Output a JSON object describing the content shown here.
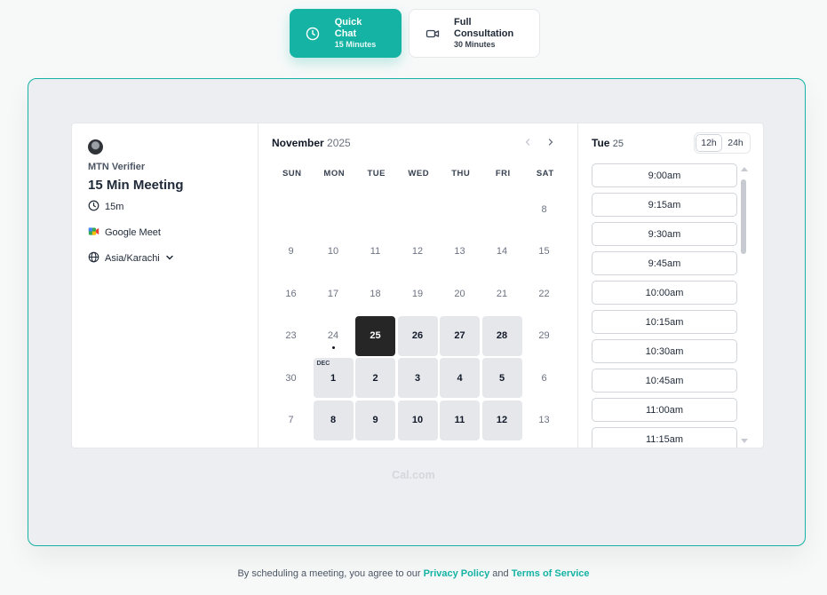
{
  "tabs": [
    {
      "title": "Quick Chat",
      "subtitle": "15 Minutes",
      "icon": "clock-icon"
    },
    {
      "title": "Full Consultation",
      "subtitle": "30 Minutes",
      "icon": "video-icon"
    }
  ],
  "event": {
    "organizer": "MTN Verifier",
    "title": "15 Min Meeting",
    "duration": "15m",
    "location": "Google Meet",
    "timezone": "Asia/Karachi"
  },
  "calendar": {
    "month": "November",
    "year": "2025",
    "weekdays": [
      "SUN",
      "MON",
      "TUE",
      "WED",
      "THU",
      "FRI",
      "SAT"
    ],
    "cells": [
      {
        "label": ""
      },
      {
        "label": ""
      },
      {
        "label": ""
      },
      {
        "label": ""
      },
      {
        "label": ""
      },
      {
        "label": ""
      },
      {
        "label": "8"
      },
      {
        "label": "9"
      },
      {
        "label": "10"
      },
      {
        "label": "11"
      },
      {
        "label": "12"
      },
      {
        "label": "13"
      },
      {
        "label": "14"
      },
      {
        "label": "15"
      },
      {
        "label": "16"
      },
      {
        "label": "17"
      },
      {
        "label": "18"
      },
      {
        "label": "19"
      },
      {
        "label": "20"
      },
      {
        "label": "21"
      },
      {
        "label": "22"
      },
      {
        "label": "23"
      },
      {
        "label": "24",
        "today": true
      },
      {
        "label": "25",
        "state": "selected"
      },
      {
        "label": "26",
        "state": "available"
      },
      {
        "label": "27",
        "state": "available"
      },
      {
        "label": "28",
        "state": "available"
      },
      {
        "label": "29"
      },
      {
        "label": "30"
      },
      {
        "label": "1",
        "state": "available",
        "month_tag": "DEC"
      },
      {
        "label": "2",
        "state": "available"
      },
      {
        "label": "3",
        "state": "available"
      },
      {
        "label": "4",
        "state": "available"
      },
      {
        "label": "5",
        "state": "available"
      },
      {
        "label": "6"
      },
      {
        "label": "7"
      },
      {
        "label": "8",
        "state": "available"
      },
      {
        "label": "9",
        "state": "available"
      },
      {
        "label": "10",
        "state": "available"
      },
      {
        "label": "11",
        "state": "available"
      },
      {
        "label": "12",
        "state": "available"
      },
      {
        "label": "13"
      }
    ]
  },
  "slots": {
    "day": "Tue",
    "date": "25",
    "format_options": [
      "12h",
      "24h"
    ],
    "selected_format": "12h",
    "times": [
      "9:00am",
      "9:15am",
      "9:30am",
      "9:45am",
      "10:00am",
      "10:15am",
      "10:30am",
      "10:45am",
      "11:00am",
      "11:15am"
    ]
  },
  "brand": "Cal.com",
  "footer": {
    "prefix": "By scheduling a meeting, you agree to our",
    "privacy": "Privacy Policy",
    "and": "and",
    "terms": "Terms of Service"
  },
  "colors": {
    "accent": "#14b3a3",
    "selected_day": "#262626",
    "available_day": "#e5e7eb",
    "frame_bg": "#eceef1"
  }
}
